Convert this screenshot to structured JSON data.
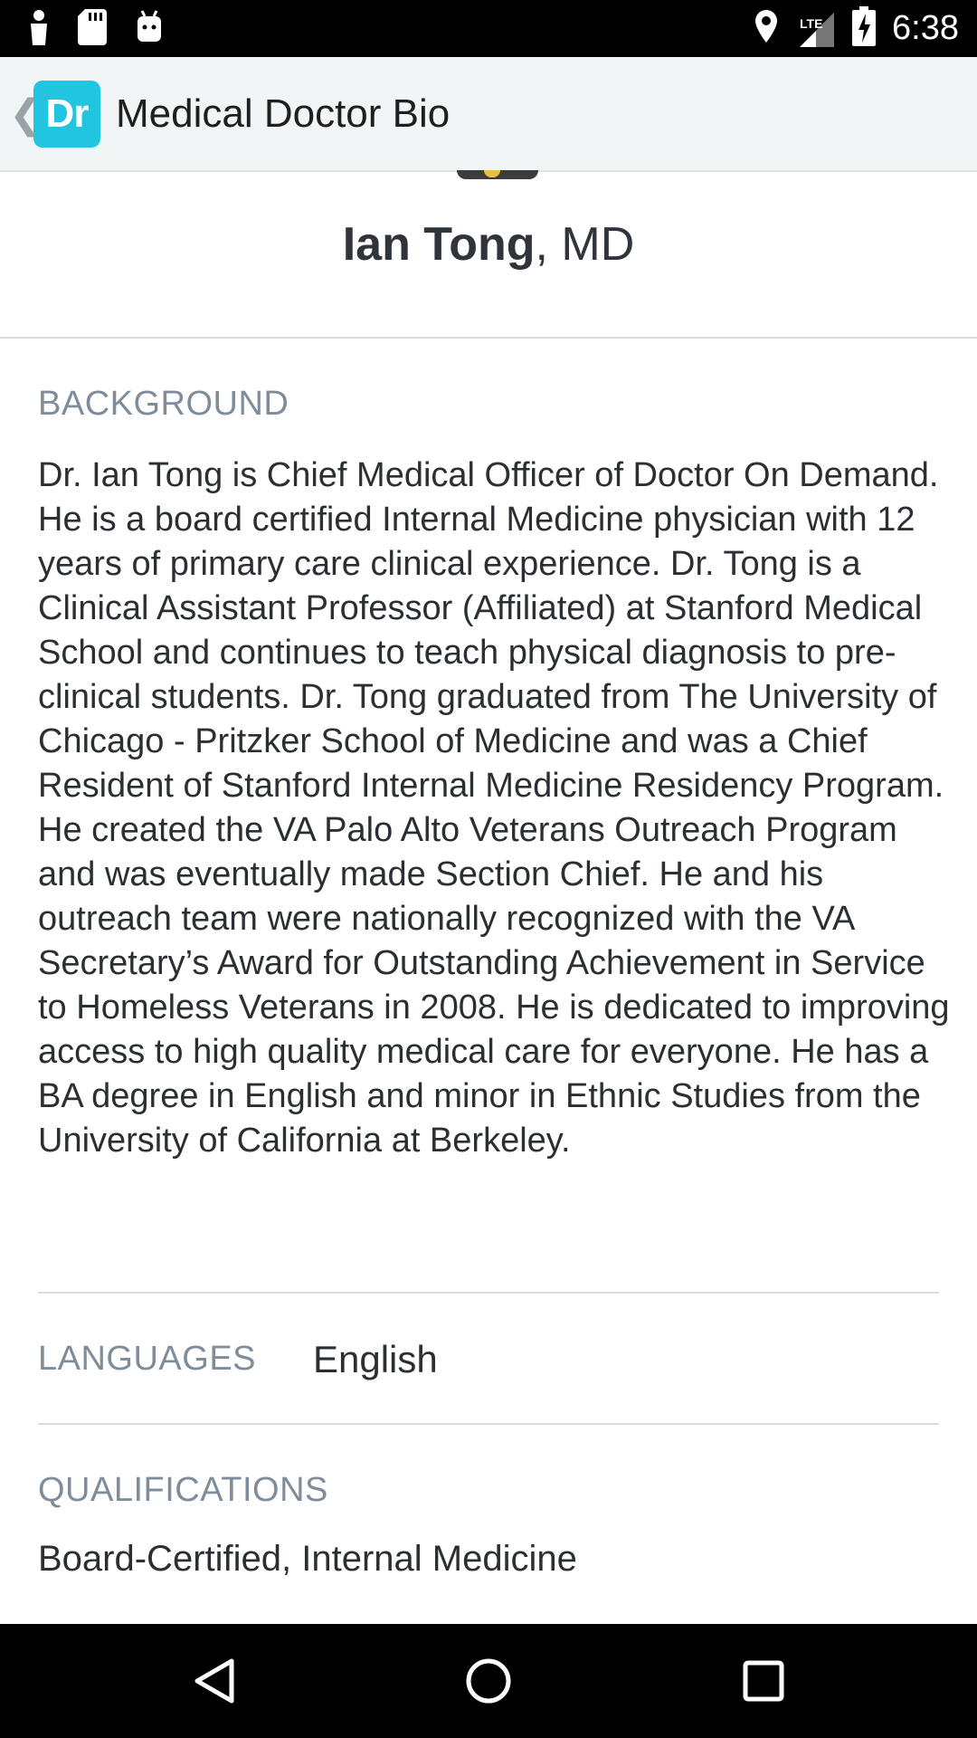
{
  "status_bar": {
    "time": "6:38",
    "lte": "LTE",
    "icons": [
      "person-icon",
      "sd-card-icon",
      "android-icon",
      "location-icon",
      "signal-icon",
      "battery-charging-icon"
    ]
  },
  "app_bar": {
    "logo_text": "Dr",
    "title": "Medical Doctor Bio",
    "back_icon": "chevron-left-icon",
    "logo_color": "#22c5df"
  },
  "doctor": {
    "name": "Ian Tong",
    "suffix": ", MD"
  },
  "background": {
    "label": "BACKGROUND",
    "text": "Dr. Ian Tong is Chief Medical Officer of Doctor On Demand. He is a board certified Internal Medicine physician with 12 years of primary care clinical experience. Dr. Tong is a Clinical Assistant Professor (Affiliated) at Stanford Medical School and continues to teach physical diagnosis to pre-clinical students. Dr. Tong graduated from The University of Chicago - Pritzker School of Medicine and was a Chief Resident of Stanford Internal Medicine Residency Program. He created the VA Palo Alto Veterans Outreach Program and was eventually made Section Chief. He and his outreach team were nationally recognized with the VA Secretary’s Award for Outstanding Achievement in Service to Homeless Veterans in 2008. He is dedicated to improving access to high quality medical care for everyone. He has a BA degree in English and minor in Ethnic Studies from the University of California at Berkeley."
  },
  "languages": {
    "label": "LANGUAGES",
    "value": "English"
  },
  "qualifications": {
    "label": "QUALIFICATIONS",
    "value": "Board-Certified, Internal Medicine"
  },
  "nav_bar": {
    "icons": [
      "back-triangle-icon",
      "home-circle-icon",
      "recents-square-icon"
    ]
  }
}
